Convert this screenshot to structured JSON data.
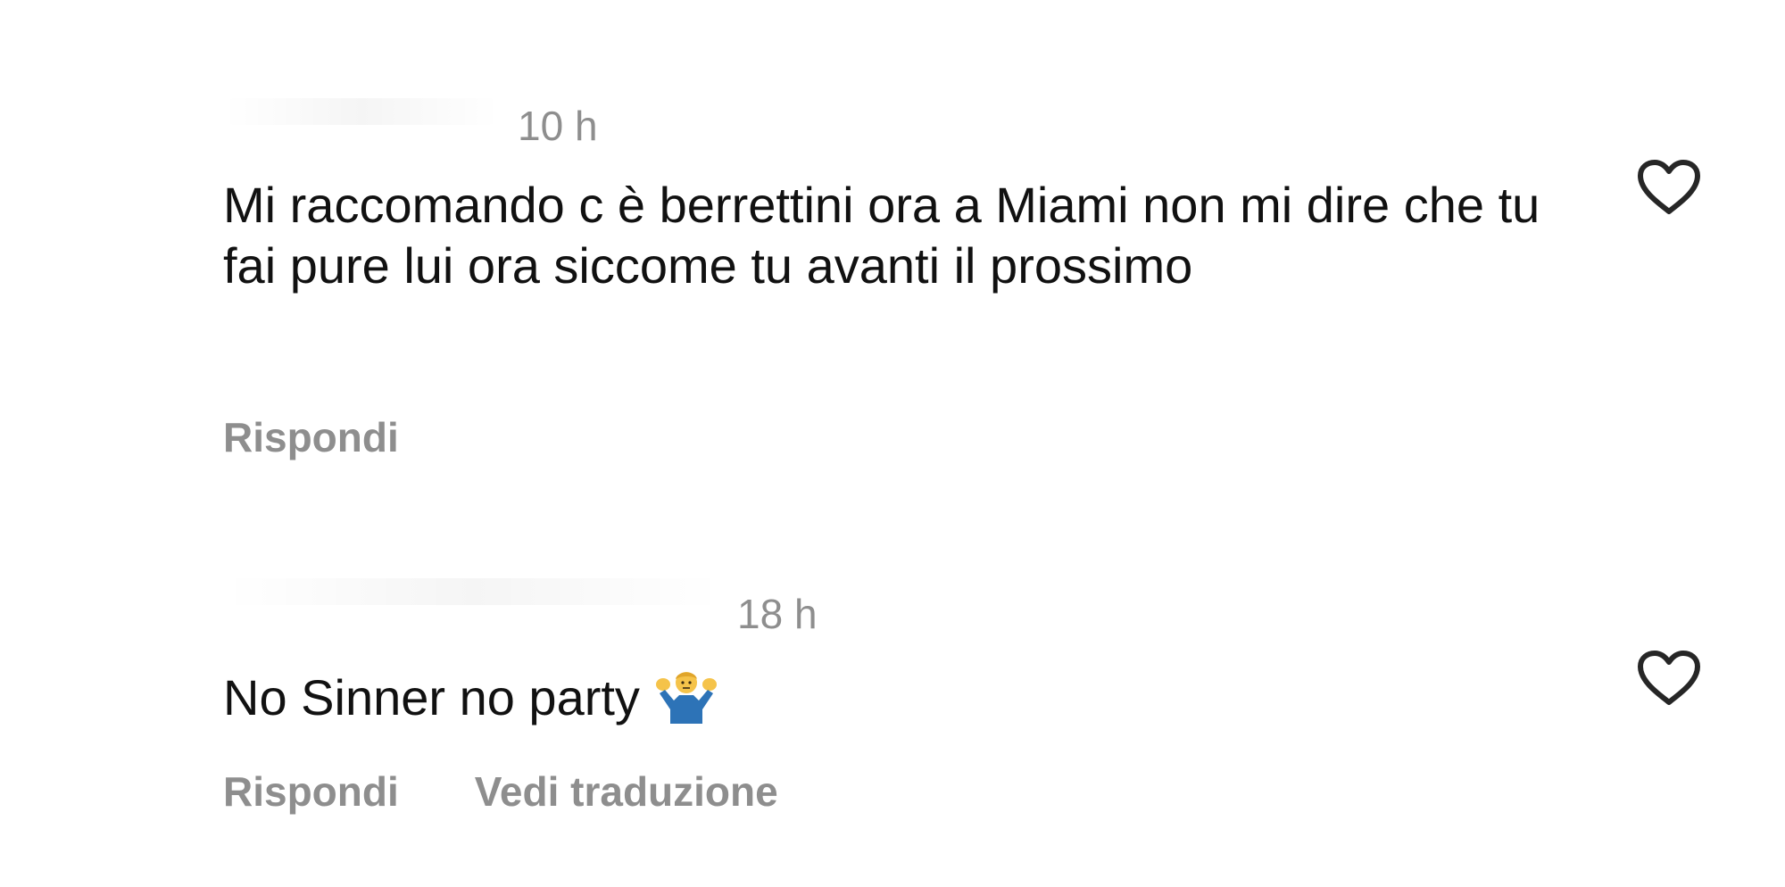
{
  "comments": [
    {
      "timestamp": "10 h",
      "text": "Mi raccomando c è berrettini ora a Miami non mi dire che tu fai pure lui ora siccome tu avanti il prossimo",
      "actions": {
        "reply_label": "Rispondi"
      },
      "like_icon": "heart-outline-icon"
    },
    {
      "timestamp": "18 h",
      "text": "No Sinner no party",
      "emoji": "person-shrugging-emoji",
      "actions": {
        "reply_label": "Rispondi",
        "translate_label": "Vedi traduzione"
      },
      "like_icon": "heart-outline-icon"
    }
  ],
  "colors": {
    "text": "#111111",
    "secondary_text": "#8e8e8e",
    "icon": "#262626",
    "background": "#ffffff"
  }
}
